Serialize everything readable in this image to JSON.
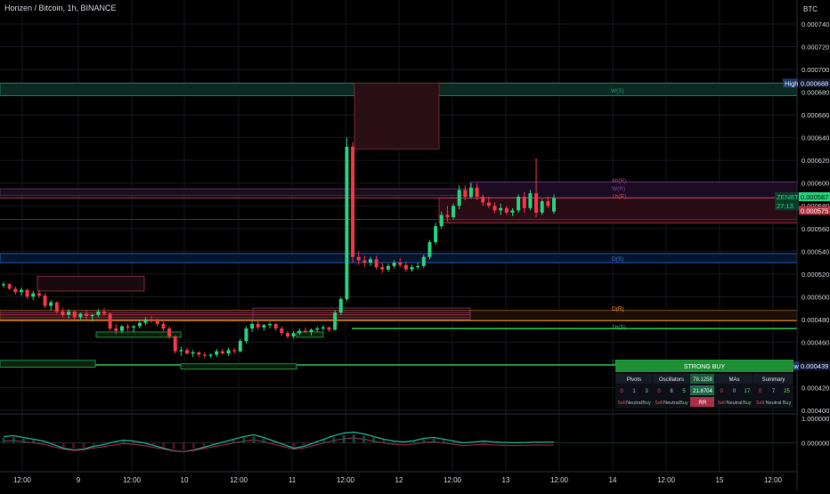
{
  "header": {
    "title": "Horizen / Bitcoin, 1h, BINANCE",
    "currency": "BTC"
  },
  "colors": {
    "up": "#26d07c",
    "down": "#f23645",
    "background": "#000000",
    "axis_text": "#cfd3dc",
    "grid": "#141821",
    "high_line": "#1e7a64",
    "support_green": "#23c552",
    "blue_level": "#1f5aa8",
    "orange_level": "#f39c12",
    "red_zone": "#8a2a36"
  },
  "badges": {
    "high_label": "High",
    "high_value": "0.000688",
    "low_label": "Low",
    "low_value": "0.000439",
    "symbol_label": "ZENBTC",
    "symbol_value": "0.000587",
    "countdown": "27:13",
    "red_value": "0.000575"
  },
  "level_labels": {
    "w_s": "W(S)",
    "r4": "4h(R)",
    "w_r": "W(R)",
    "r1h": "1h(R)",
    "d_s": "D(S)",
    "d_r": "D(R)",
    "s1h": "1h(S)",
    "d_s2": "D(S)"
  },
  "summary_table": {
    "title": "STRONG BUY",
    "columns": [
      "Pivots",
      "Oscillators",
      "78.1258",
      "MAs",
      "Summary"
    ],
    "pivots": {
      "sell": "0",
      "neutral": "1",
      "buy": "3"
    },
    "oscillators": {
      "sell": "0",
      "neutral": "8",
      "buy": "5"
    },
    "value_row": "21.8704",
    "mas": {
      "sell": "0",
      "neutral": "0",
      "buy": "17"
    },
    "summary": {
      "sell": "0",
      "neutral": "7",
      "buy": "25"
    },
    "labels": {
      "sell": "Sell",
      "neutral": "Neutral",
      "buy": "Buy"
    },
    "sub_value": "RR"
  },
  "oscillator_panel": {
    "top_tick": "1.000000",
    "mid_tick": "0.000000"
  },
  "chart_data": {
    "type": "candlestick",
    "title": "Horizen / Bitcoin, 1h, BINANCE",
    "y_unit": "BTC",
    "ylim": [
      0.0004,
      0.00075
    ],
    "y_ticks": [
      "0.000740",
      "0.000720",
      "0.000700",
      "0.000680",
      "0.000660",
      "0.000640",
      "0.000620",
      "0.000600",
      "0.000580",
      "0.000560",
      "0.000540",
      "0.000520",
      "0.000500",
      "0.000480",
      "0.000460",
      "0.000440",
      "0.000420",
      "0.000400"
    ],
    "x_ticks": [
      "12:00",
      "9",
      "12:00",
      "10",
      "12:00",
      "11",
      "12:00",
      "12",
      "12:00",
      "13",
      "12:00",
      "14",
      "12:00",
      "15",
      "12:00"
    ],
    "levels": {
      "high": 0.000688,
      "low": 0.000439,
      "last": 0.000587,
      "w_s": 0.000677,
      "r4": 0.000601,
      "w_r": 0.000594,
      "r1h": 0.000587,
      "d_s": 0.000485,
      "s1h": 0.000472
    },
    "candles": [
      [
        0.00051,
        0.000513,
        0.000508,
        0.000511
      ],
      [
        0.000511,
        0.000512,
        0.000506,
        0.000507
      ],
      [
        0.000507,
        0.000509,
        0.000502,
        0.000504
      ],
      [
        0.000504,
        0.000508,
        0.000501,
        0.000506
      ],
      [
        0.000506,
        0.000507,
        0.000498,
        0.0005
      ],
      [
        0.0005,
        0.000505,
        0.000497,
        0.000503
      ],
      [
        0.000503,
        0.000506,
        0.000499,
        0.000501
      ],
      [
        0.000501,
        0.000503,
        0.00049,
        0.000492
      ],
      [
        0.000492,
        0.000497,
        0.000488,
        0.000495
      ],
      [
        0.000495,
        0.000496,
        0.000485,
        0.000487
      ],
      [
        0.000487,
        0.00049,
        0.000482,
        0.000484
      ],
      [
        0.000484,
        0.000489,
        0.000481,
        0.000487
      ],
      [
        0.000487,
        0.000488,
        0.00048,
        0.000482
      ],
      [
        0.000482,
        0.000486,
        0.000479,
        0.000485
      ],
      [
        0.000485,
        0.000488,
        0.00048,
        0.000483
      ],
      [
        0.000483,
        0.000485,
        0.000478,
        0.000484
      ],
      [
        0.000484,
        0.000489,
        0.000482,
        0.000487
      ],
      [
        0.000487,
        0.00049,
        0.000483,
        0.000485
      ],
      [
        0.000485,
        0.000486,
        0.00047,
        0.000472
      ],
      [
        0.000472,
        0.000476,
        0.000467,
        0.00047
      ],
      [
        0.00047,
        0.000475,
        0.000468,
        0.000474
      ],
      [
        0.000474,
        0.000476,
        0.00047,
        0.000473
      ],
      [
        0.000473,
        0.000475,
        0.000469,
        0.000474
      ],
      [
        0.000474,
        0.000479,
        0.000472,
        0.000477
      ],
      [
        0.000477,
        0.000482,
        0.000475,
        0.00048
      ],
      [
        0.00048,
        0.000483,
        0.000477,
        0.000479
      ],
      [
        0.000479,
        0.000481,
        0.000474,
        0.000476
      ],
      [
        0.000476,
        0.000478,
        0.00047,
        0.000472
      ],
      [
        0.000472,
        0.000474,
        0.000463,
        0.000465
      ],
      [
        0.000465,
        0.000466,
        0.00045,
        0.000452
      ],
      [
        0.000452,
        0.000456,
        0.000448,
        0.000453
      ],
      [
        0.000453,
        0.000455,
        0.000449,
        0.00045
      ],
      [
        0.00045,
        0.000453,
        0.000447,
        0.000451
      ],
      [
        0.000451,
        0.000452,
        0.000447,
        0.000449
      ],
      [
        0.000449,
        0.000451,
        0.000446,
        0.000448
      ],
      [
        0.000448,
        0.00045,
        0.000446,
        0.000449
      ],
      [
        0.000449,
        0.000454,
        0.000447,
        0.000452
      ],
      [
        0.000452,
        0.000454,
        0.000449,
        0.00045
      ],
      [
        0.00045,
        0.000455,
        0.000448,
        0.000453
      ],
      [
        0.000453,
        0.000455,
        0.00045,
        0.000452
      ],
      [
        0.000452,
        0.000463,
        0.000451,
        0.000461
      ],
      [
        0.000461,
        0.000474,
        0.000459,
        0.000472
      ],
      [
        0.000472,
        0.000478,
        0.000469,
        0.000476
      ],
      [
        0.000476,
        0.000479,
        0.000471,
        0.000473
      ],
      [
        0.000473,
        0.000476,
        0.00047,
        0.000475
      ],
      [
        0.000475,
        0.000478,
        0.000472,
        0.000476
      ],
      [
        0.000476,
        0.000477,
        0.00047,
        0.000472
      ],
      [
        0.000472,
        0.000474,
        0.000466,
        0.000468
      ],
      [
        0.000468,
        0.00047,
        0.000463,
        0.000465
      ],
      [
        0.000465,
        0.00047,
        0.000463,
        0.000468
      ],
      [
        0.000468,
        0.000472,
        0.000466,
        0.00047
      ],
      [
        0.00047,
        0.000473,
        0.000468,
        0.000469
      ],
      [
        0.000469,
        0.000472,
        0.000466,
        0.000471
      ],
      [
        0.000471,
        0.000474,
        0.000469,
        0.000472
      ],
      [
        0.000472,
        0.000475,
        0.00047,
        0.000473
      ],
      [
        0.000473,
        0.000474,
        0.000469,
        0.000471
      ],
      [
        0.000471,
        0.000488,
        0.00047,
        0.000486
      ],
      [
        0.000486,
        0.0005,
        0.000484,
        0.000498
      ],
      [
        0.000498,
        0.00064,
        0.000496,
        0.000632
      ],
      [
        0.000632,
        0.000636,
        0.00053,
        0.000535
      ],
      [
        0.000535,
        0.00054,
        0.000528,
        0.000532
      ],
      [
        0.000532,
        0.000536,
        0.000526,
        0.00053
      ],
      [
        0.00053,
        0.000535,
        0.000527,
        0.000533
      ],
      [
        0.000533,
        0.000536,
        0.000524,
        0.000526
      ],
      [
        0.000526,
        0.00053,
        0.000521,
        0.000524
      ],
      [
        0.000524,
        0.000529,
        0.000522,
        0.000527
      ],
      [
        0.000527,
        0.000532,
        0.000525,
        0.00053
      ],
      [
        0.00053,
        0.000534,
        0.000526,
        0.000528
      ],
      [
        0.000528,
        0.000531,
        0.000522,
        0.000524
      ],
      [
        0.000524,
        0.000528,
        0.000522,
        0.000526
      ],
      [
        0.000526,
        0.00053,
        0.000524,
        0.000527
      ],
      [
        0.000527,
        0.000537,
        0.000525,
        0.000535
      ],
      [
        0.000535,
        0.00055,
        0.000533,
        0.000548
      ],
      [
        0.000548,
        0.000565,
        0.000546,
        0.000562
      ],
      [
        0.000562,
        0.000575,
        0.00056,
        0.000572
      ],
      [
        0.000572,
        0.00058,
        0.000566,
        0.00057
      ],
      [
        0.00057,
        0.000582,
        0.000568,
        0.00058
      ],
      [
        0.00058,
        0.000598,
        0.000577,
        0.000594
      ],
      [
        0.000594,
        0.000598,
        0.000585,
        0.000588
      ],
      [
        0.000588,
        0.0006,
        0.000586,
        0.000596
      ],
      [
        0.000596,
        0.0006,
        0.000585,
        0.000588
      ],
      [
        0.000588,
        0.00059,
        0.00058,
        0.000583
      ],
      [
        0.000583,
        0.000588,
        0.000578,
        0.00058
      ],
      [
        0.00058,
        0.000583,
        0.000574,
        0.000576
      ],
      [
        0.000576,
        0.000582,
        0.000572,
        0.000578
      ],
      [
        0.000578,
        0.00058,
        0.000572,
        0.000574
      ],
      [
        0.000574,
        0.000578,
        0.000571,
        0.000576
      ],
      [
        0.000576,
        0.00059,
        0.000574,
        0.000588
      ],
      [
        0.000588,
        0.000592,
        0.000574,
        0.000578
      ],
      [
        0.000578,
        0.000594,
        0.000576,
        0.000591
      ],
      [
        0.000591,
        0.000622,
        0.00057,
        0.000574
      ],
      [
        0.000574,
        0.000586,
        0.000572,
        0.000584
      ],
      [
        0.000584,
        0.000588,
        0.000578,
        0.00058
      ],
      [
        0.000575,
        0.00059,
        0.000573,
        0.000587
      ]
    ],
    "oscillator": {
      "ylim": [
        -1,
        1
      ],
      "values": [
        0.35,
        0.4,
        0.3,
        0.2,
        0.1,
        -0.1,
        -0.3,
        -0.4,
        -0.35,
        -0.2,
        -0.1,
        0.05,
        0.15,
        0.1,
        0.0,
        -0.15,
        -0.3,
        -0.45,
        -0.5,
        -0.4,
        -0.25,
        -0.1,
        0.05,
        0.2,
        0.35,
        0.45,
        0.3,
        0.1,
        -0.1,
        -0.3,
        -0.2,
        0.0,
        0.2,
        0.4,
        0.55,
        0.6,
        0.5,
        0.35,
        0.2,
        0.1,
        0.05,
        0.12,
        0.25,
        0.3,
        0.2,
        0.1,
        0.0,
        0.05,
        0.1,
        0.05,
        0.02,
        0.0,
        0.02,
        0.03,
        0.04,
        0.04
      ]
    }
  }
}
